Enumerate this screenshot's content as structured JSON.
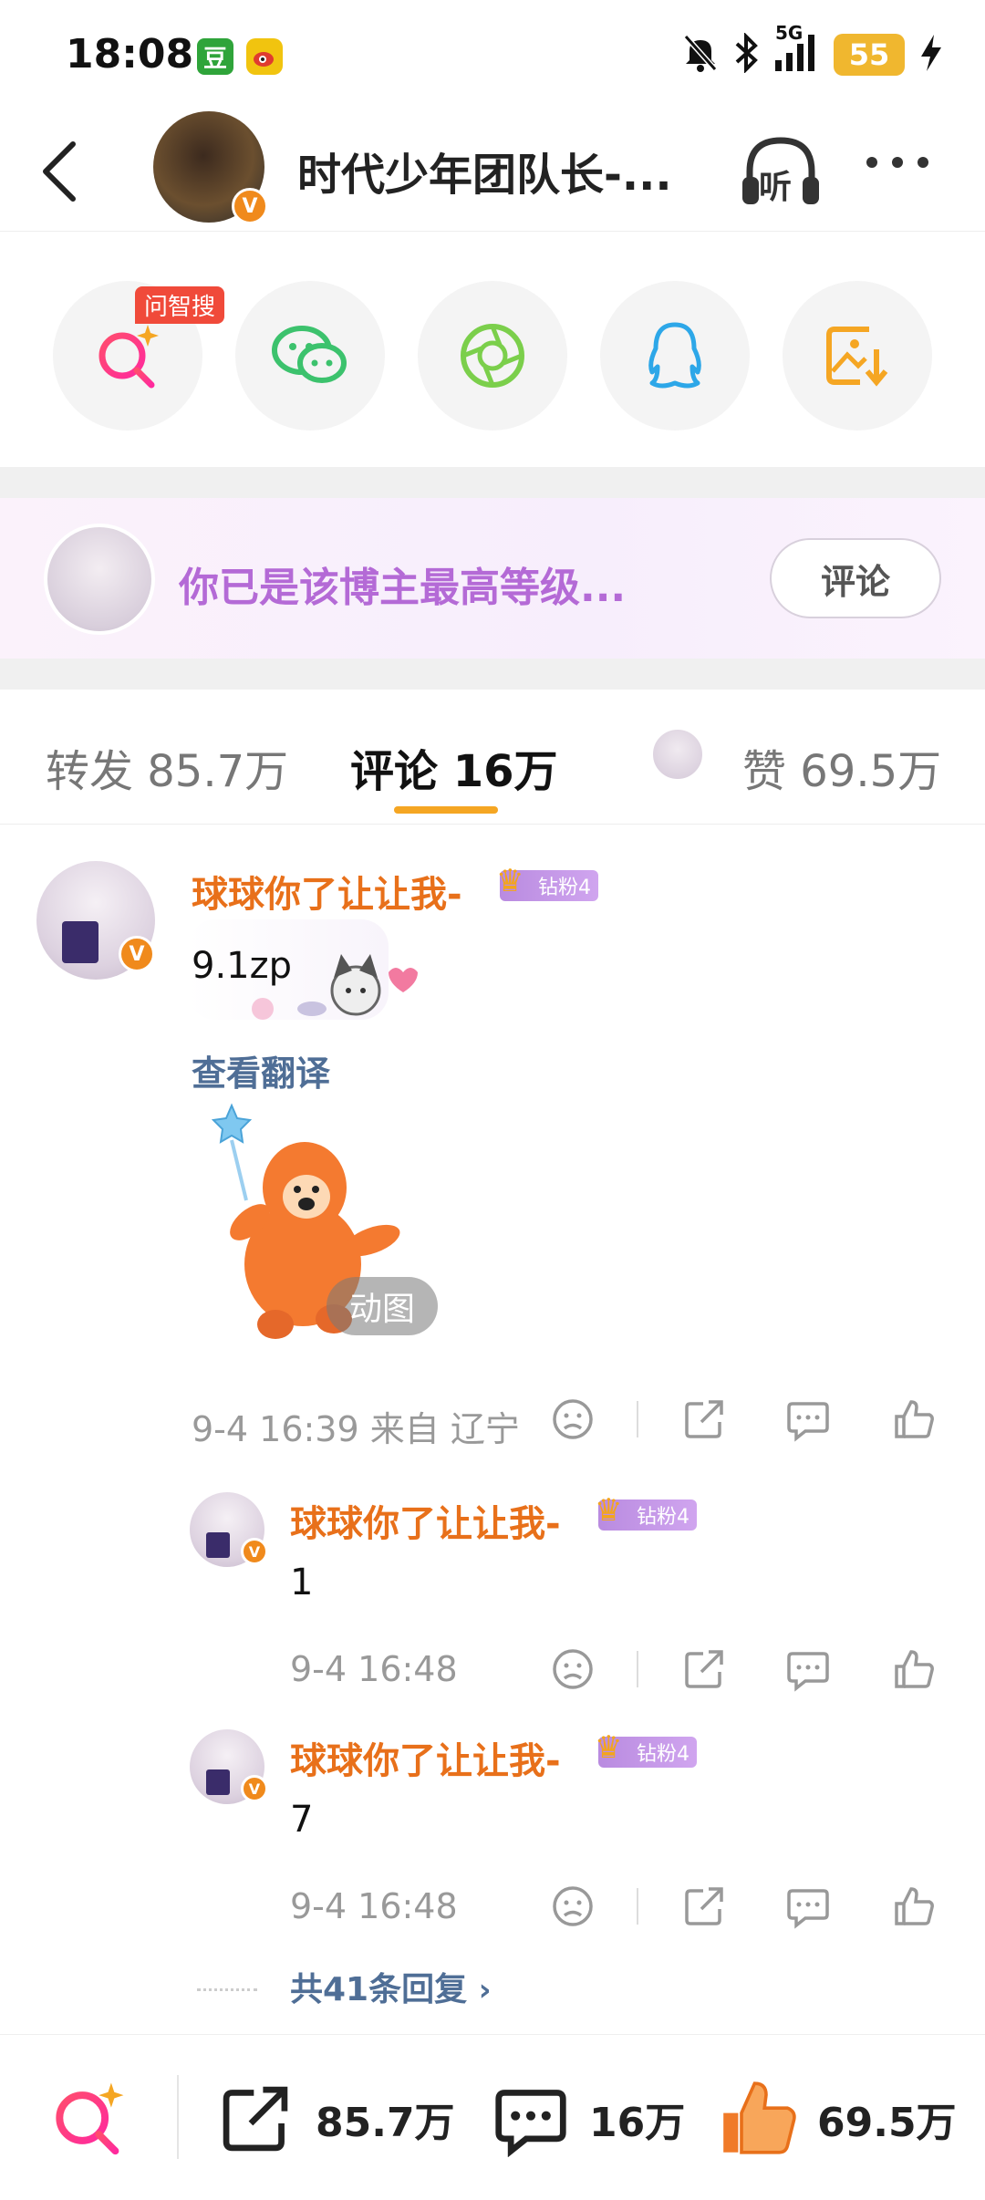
{
  "status_bar": {
    "time": "18:08",
    "app1": "豆",
    "network": "5G",
    "battery": "55"
  },
  "header": {
    "title": "时代少年团队长-...",
    "listen_label": "听"
  },
  "share": {
    "zhisou_tag": "问智搜",
    "items": [
      "zhisou-icon",
      "wechat-icon",
      "moments-icon",
      "qq-icon",
      "save-image-icon"
    ]
  },
  "banner": {
    "text": "你已是该博主最高等级...",
    "button": "评论",
    "color": "#b46ad6"
  },
  "tabs": {
    "repost": "转发 85.7万",
    "comment": "评论 16万",
    "like": "赞 69.5万",
    "accent": "#f5a623"
  },
  "comment": {
    "author": "球球你了让让我-",
    "fan_badge": "钻粉4",
    "text": "9.1zp",
    "translate": "查看翻译",
    "gif_label": "动图",
    "time_location": "9-4 16:39  来自 辽宁",
    "name_color": "#e8701a"
  },
  "replies": [
    {
      "author": "球球你了让让我-",
      "fan_badge": "钻粉4",
      "text": "1",
      "time": "9-4 16:48"
    },
    {
      "author": "球球你了让让我-",
      "fan_badge": "钻粉4",
      "text": "7",
      "time": "9-4 16:48"
    }
  ],
  "more_replies": "共41条回复",
  "bottom_bar": {
    "repost_count": "85.7万",
    "comment_count": "16万",
    "like_count": "69.5万"
  }
}
